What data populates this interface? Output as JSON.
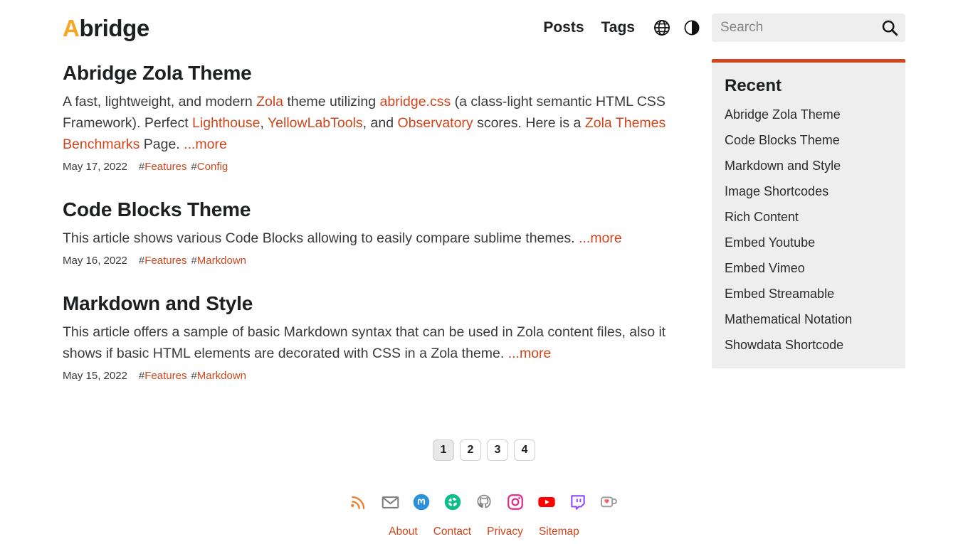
{
  "site": {
    "logo_accent": "A",
    "logo_rest": "bridge",
    "accent_color": "#f5a623",
    "link_color": "#d0451b"
  },
  "header": {
    "nav": [
      {
        "label": "Posts",
        "name": "nav-posts"
      },
      {
        "label": "Tags",
        "name": "nav-tags"
      }
    ],
    "icons": [
      {
        "name": "globe-icon",
        "label": "Language"
      },
      {
        "name": "contrast-icon",
        "label": "Theme"
      }
    ],
    "search": {
      "placeholder": "Search",
      "value": "",
      "icon": "search-icon"
    }
  },
  "posts": [
    {
      "title": "Abridge Zola Theme",
      "summary_parts": [
        {
          "t": "A fast, lightweight, and modern ",
          "link": false
        },
        {
          "t": "Zola",
          "link": true
        },
        {
          "t": " theme utilizing ",
          "link": false
        },
        {
          "t": "abridge.css",
          "link": true
        },
        {
          "t": " (a class-light semantic HTML CSS Framework). Perfect ",
          "link": false
        },
        {
          "t": "Lighthouse",
          "link": true
        },
        {
          "t": ", ",
          "link": false
        },
        {
          "t": "YellowLabTools",
          "link": true
        },
        {
          "t": ", and ",
          "link": false
        },
        {
          "t": "Observatory",
          "link": true
        },
        {
          "t": " scores. Here is a ",
          "link": false
        },
        {
          "t": "Zola Themes Benchmarks",
          "link": true
        },
        {
          "t": " Page. ",
          "link": false
        }
      ],
      "more": "...more",
      "date": "May 17, 2022",
      "tags": [
        "Features",
        "Config"
      ]
    },
    {
      "title": "Code Blocks Theme",
      "summary_parts": [
        {
          "t": "This article shows various Code Blocks allowing to easily compare sublime themes. ",
          "link": false
        }
      ],
      "more": "...more",
      "date": "May 16, 2022",
      "tags": [
        "Features",
        "Markdown"
      ]
    },
    {
      "title": "Markdown and Style",
      "summary_parts": [
        {
          "t": "This article offers a sample of basic Markdown syntax that can be used in Zola content files, also it shows if basic HTML elements are decorated with CSS in a Zola theme. ",
          "link": false
        }
      ],
      "more": "...more",
      "date": "May 15, 2022",
      "tags": [
        "Features",
        "Markdown"
      ]
    }
  ],
  "sidebar": {
    "title": "Recent",
    "items": [
      "Abridge Zola Theme",
      "Code Blocks Theme",
      "Markdown and Style",
      "Image Shortcodes",
      "Rich Content",
      "Embed Youtube",
      "Embed Vimeo",
      "Embed Streamable",
      "Mathematical Notation",
      "Showdata Shortcode"
    ]
  },
  "pagination": {
    "pages": [
      "1",
      "2",
      "3",
      "4"
    ],
    "active_index": 0
  },
  "footer": {
    "social": [
      {
        "name": "rss-icon",
        "label": "RSS",
        "color": "#ee802f"
      },
      {
        "name": "email-icon",
        "label": "Email",
        "color": "#7d7d7d"
      },
      {
        "name": "mastodon-icon",
        "label": "Mastodon",
        "color": "#2b90d9"
      },
      {
        "name": "element-icon",
        "label": "Element",
        "color": "#0dbd8b"
      },
      {
        "name": "github-icon",
        "label": "GitHub",
        "color": "#7d7d7d"
      },
      {
        "name": "instagram-icon",
        "label": "Instagram",
        "color": "#e4268a"
      },
      {
        "name": "youtube-icon",
        "label": "YouTube",
        "color": "#ff0000"
      },
      {
        "name": "twitch-icon",
        "label": "Twitch",
        "color": "#9146ff"
      },
      {
        "name": "kofi-icon",
        "label": "Ko-fi",
        "color": "#ff5e5b"
      }
    ],
    "links": [
      "About",
      "Contact",
      "Privacy",
      "Sitemap"
    ]
  }
}
